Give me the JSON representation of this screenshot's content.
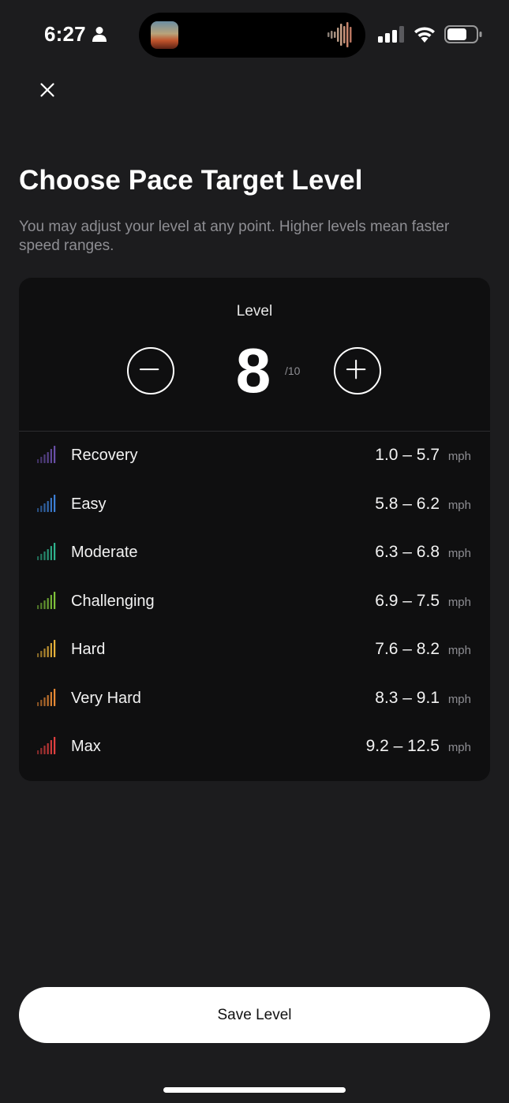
{
  "status_bar": {
    "time": "6:27",
    "icons": [
      "person-icon",
      "now-playing-art",
      "audio-wave-icon",
      "signal-icon",
      "wifi-icon",
      "battery-icon"
    ]
  },
  "header": {
    "close_icon": "close-icon"
  },
  "title": "Choose Pace Target Level",
  "subtitle": "You may adjust your level at any point. Higher levels mean faster speed ranges.",
  "level_card": {
    "label": "Level",
    "value": "8",
    "max": "/10",
    "decrease_icon": "minus-circle-icon",
    "increase_icon": "plus-circle-icon"
  },
  "zones": [
    {
      "name": "Recovery",
      "range": "1.0 – 5.7",
      "unit": "mph",
      "color": "#6a4fa8"
    },
    {
      "name": "Easy",
      "range": "5.8 – 6.2",
      "unit": "mph",
      "color": "#3d7fd6"
    },
    {
      "name": "Moderate",
      "range": "6.3 – 6.8",
      "unit": "mph",
      "color": "#2fb58f"
    },
    {
      "name": "Challenging",
      "range": "6.9 – 7.5",
      "unit": "mph",
      "color": "#7fc23a"
    },
    {
      "name": "Hard",
      "range": "7.6 – 8.2",
      "unit": "mph",
      "color": "#e8b23a"
    },
    {
      "name": "Very Hard",
      "range": "8.3 – 9.1",
      "unit": "mph",
      "color": "#e98a35"
    },
    {
      "name": "Max",
      "range": "9.2 – 12.5",
      "unit": "mph",
      "color": "#e24040"
    }
  ],
  "save_button": {
    "label": "Save Level"
  }
}
